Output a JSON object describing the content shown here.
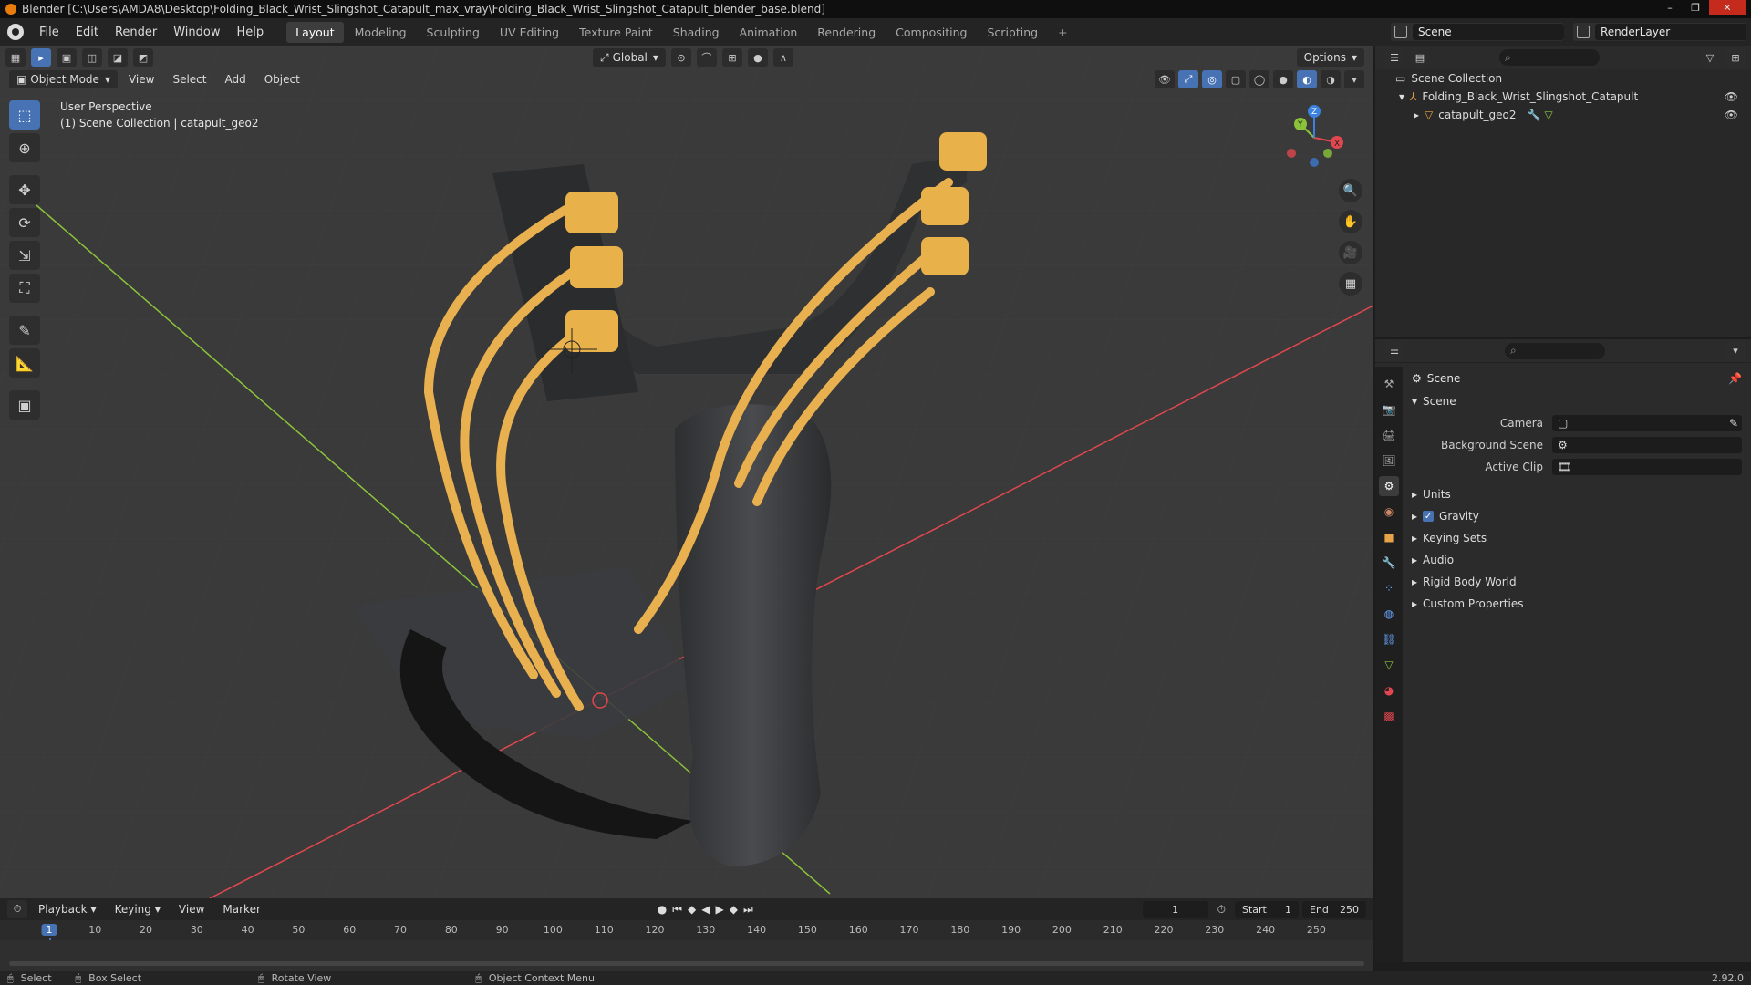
{
  "window": {
    "title": "Blender [C:\\Users\\AMDA8\\Desktop\\Folding_Black_Wrist_Slingshot_Catapult_max_vray\\Folding_Black_Wrist_Slingshot_Catapult_blender_base.blend]",
    "minimize": "–",
    "maximize": "❐",
    "close": "✕"
  },
  "menu": {
    "items": [
      "File",
      "Edit",
      "Render",
      "Window",
      "Help"
    ],
    "workspaces": [
      "Layout",
      "Modeling",
      "Sculpting",
      "UV Editing",
      "Texture Paint",
      "Shading",
      "Animation",
      "Rendering",
      "Compositing",
      "Scripting"
    ],
    "active_workspace": "Layout",
    "add_workspace": "+",
    "scene_label": "Scene",
    "render_layer": "RenderLayer"
  },
  "viewport": {
    "transform_orientation": "Global",
    "options_label": "Options",
    "mode": "Object Mode",
    "header_menus": [
      "View",
      "Select",
      "Add",
      "Object"
    ],
    "overlay_line1": "User Perspective",
    "overlay_line2": "(1) Scene Collection | catapult_geo2",
    "gizmo_axes": {
      "x": "X",
      "y": "Y",
      "z": "Z"
    }
  },
  "outliner": {
    "root": "Scene Collection",
    "items": [
      {
        "name": "Folding_Black_Wrist_Slingshot_Catapult"
      },
      {
        "name": "catapult_geo2"
      }
    ]
  },
  "properties": {
    "context_title": "Scene",
    "panel_title": "Scene",
    "fields": [
      {
        "label": "Camera",
        "value": ""
      },
      {
        "label": "Background Scene",
        "value": ""
      },
      {
        "label": "Active Clip",
        "value": ""
      }
    ],
    "sections": [
      "Units",
      "Gravity",
      "Keying Sets",
      "Audio",
      "Rigid Body World",
      "Custom Properties"
    ],
    "gravity_checked": true
  },
  "timeline": {
    "menus": [
      "Playback",
      "Keying",
      "View",
      "Marker"
    ],
    "current_frame": "1",
    "start_label": "Start",
    "start": "1",
    "end_label": "End",
    "end": "250",
    "ruler": [
      "1",
      "10",
      "20",
      "30",
      "40",
      "50",
      "60",
      "70",
      "80",
      "90",
      "100",
      "110",
      "120",
      "130",
      "140",
      "150",
      "160",
      "170",
      "180",
      "190",
      "200",
      "210",
      "220",
      "230",
      "240",
      "250"
    ]
  },
  "status": {
    "items": [
      "Select",
      "Box Select",
      "Rotate View",
      "Object Context Menu"
    ],
    "version": "2.92.0"
  },
  "colors": {
    "accent": "#4772b3",
    "x_axis": "#e0474e",
    "y_axis": "#8bc33a",
    "z_axis": "#3b82e0",
    "rubber": "#e9b04f",
    "frame": "#3a3b3e"
  }
}
